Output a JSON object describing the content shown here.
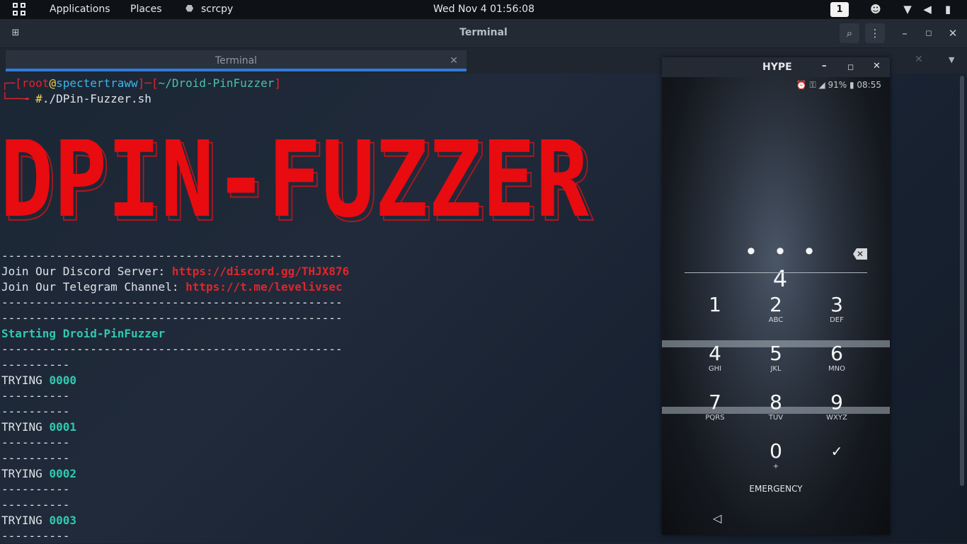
{
  "topbar": {
    "applications": "Applications",
    "places": "Places",
    "app_name": "scrcpy",
    "clock": "Wed Nov 4  01:56:08",
    "workspace": "1"
  },
  "terminal": {
    "window_title": "Terminal",
    "tab_label": "Terminal",
    "prompt": {
      "open1": "┌─[",
      "user": "root",
      "at": "@",
      "host": "spectertraww",
      "mid": "]─[",
      "path": "~/Droid-PinFuzzer",
      "close": "]",
      "line2_prefix": "└──╼ ",
      "hash": "#",
      "command": "./DPin-Fuzzer.sh"
    },
    "banner_text": "DPIN-FUZZER",
    "dashes": "--------------------------------------------------",
    "discord_label": "Join Our Discord Server: ",
    "discord_url": "https://discord.gg/THJX876",
    "telegram_label": "Join Our Telegram Channel: ",
    "telegram_url": "https://t.me/levelivsec",
    "starting": "Starting Droid-PinFuzzer",
    "short_dashes": "----------",
    "trying_label": "TRYING ",
    "attempts": [
      "0000",
      "0001",
      "0002",
      "0003"
    ]
  },
  "phone": {
    "window_title": "HYPE",
    "status_battery": "91%",
    "status_time": "08:55",
    "pin_entry": "• • • 4",
    "keys": [
      {
        "d": "1",
        "l": ""
      },
      {
        "d": "2",
        "l": "ABC"
      },
      {
        "d": "3",
        "l": "DEF"
      },
      {
        "d": "4",
        "l": "GHI"
      },
      {
        "d": "5",
        "l": "JKL"
      },
      {
        "d": "6",
        "l": "MNO"
      },
      {
        "d": "7",
        "l": "PQRS"
      },
      {
        "d": "8",
        "l": "TUV"
      },
      {
        "d": "9",
        "l": "WXYZ"
      },
      {
        "d": "0",
        "l": "+"
      }
    ],
    "confirm": "✓",
    "emergency": "EMERGENCY",
    "back": "◁"
  }
}
